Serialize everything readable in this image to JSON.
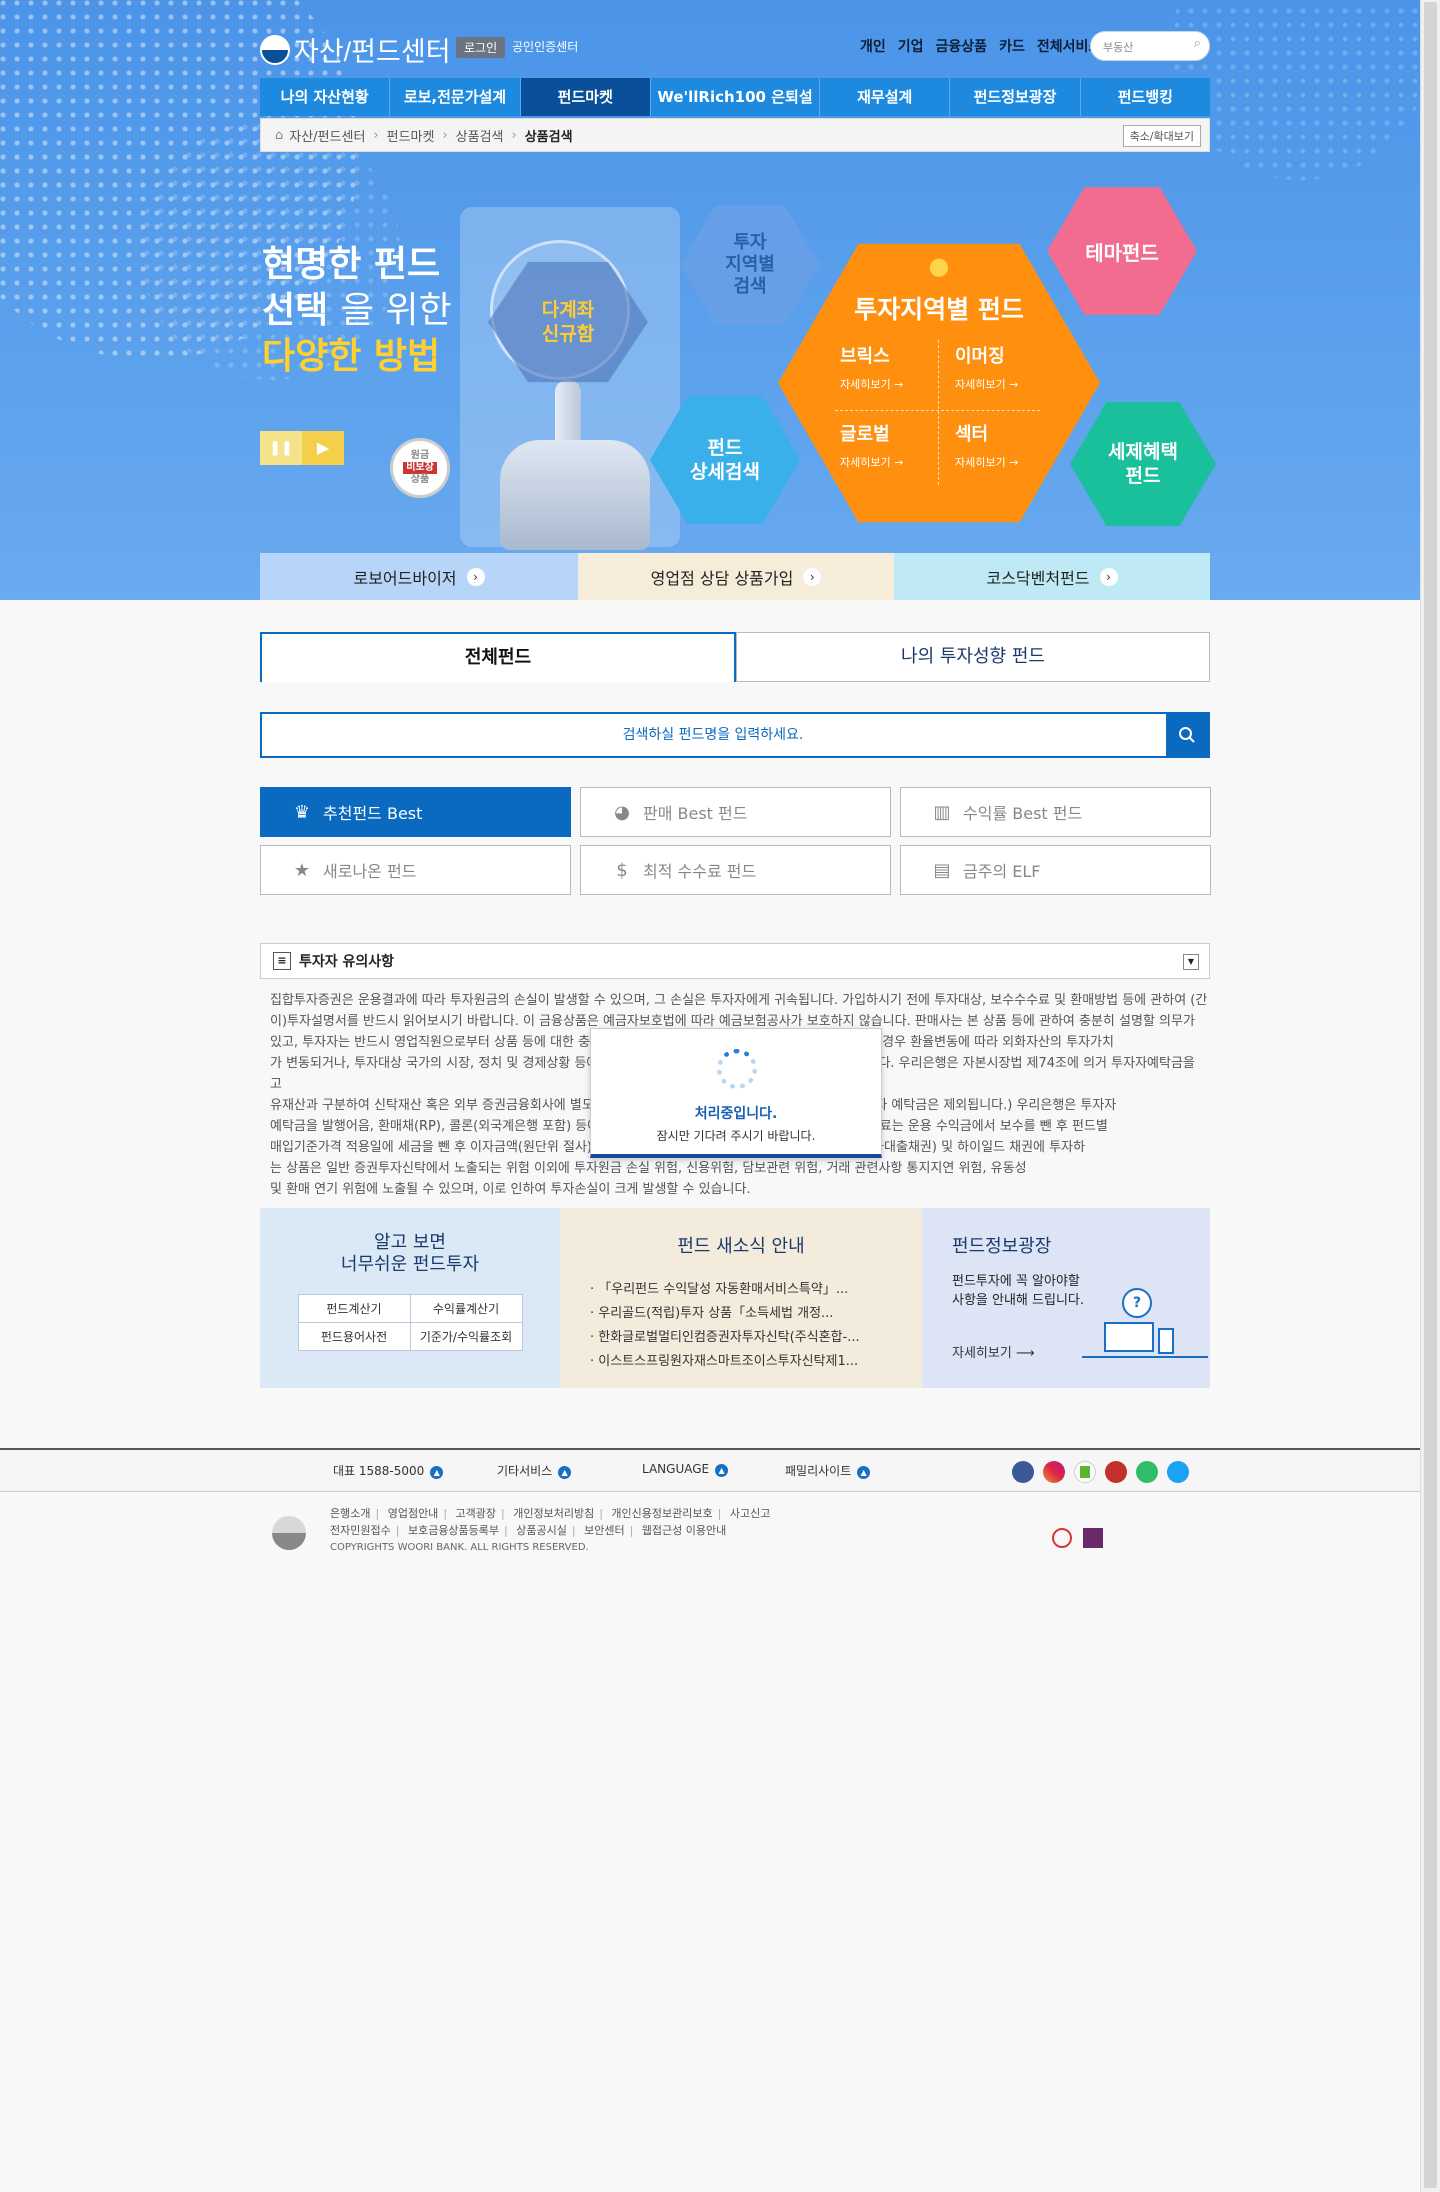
{
  "header": {
    "logo_text": "자산/펀드센터",
    "login_label": "로그인",
    "cert_label": "공인인증센터",
    "topnav": [
      "개인",
      "기업",
      "금융상품",
      "카드",
      "전체서비스"
    ],
    "search_placeholder": "부동산"
  },
  "gnb": [
    "나의 자산현황",
    "로보,전문가설계",
    "펀드마켓",
    "We'llRich100 은퇴설계",
    "재무설계",
    "펀드정보광장",
    "펀드뱅킹"
  ],
  "gnb_active": 2,
  "breadcrumb": [
    "자산/펀드센터",
    "펀드마켓",
    "상품검색",
    "상품검색"
  ],
  "zoom_label": "축소/확대보기",
  "hero": {
    "headline1": "현명한 펀드",
    "headline2a": "선택",
    "headline2b": "을 위한",
    "headline3": "다양한 방법",
    "badge_multi": "다계좌\n신규함",
    "badge_nonprotect": [
      "원금",
      "비보장",
      "상품"
    ],
    "hex_region_search": "투자\n지역별\n검색",
    "hex_theme": "테마펀드",
    "hex_detail": "펀드\n상세검색",
    "hex_tax": "세제혜택\n펀드",
    "main_hex": {
      "title": "투자지역별 펀드",
      "items": [
        {
          "label": "브릭스",
          "more": "자세히보기 →"
        },
        {
          "label": "이머징",
          "more": "자세히보기 →"
        },
        {
          "label": "글로벌",
          "more": "자세히보기 →"
        },
        {
          "label": "섹터",
          "more": "자세히보기 →"
        }
      ]
    }
  },
  "quick_links": [
    "로보어드바이저",
    "영업점 상담 상품가입",
    "코스닥벤처펀드"
  ],
  "tabs": [
    "전체펀드",
    "나의 투자성향 펀드"
  ],
  "search": {
    "placeholder": "검색하실 펀드명을 입력하세요."
  },
  "categories": [
    {
      "label": "추천펀드 Best",
      "icon": "crown-icon"
    },
    {
      "label": "판매 Best 펀드",
      "icon": "pie-icon"
    },
    {
      "label": "수익률 Best 펀드",
      "icon": "bar-chart-icon"
    },
    {
      "label": "새로나온 펀드",
      "icon": "star-icon"
    },
    {
      "label": "최적 수수료 펀드",
      "icon": "money-bag-icon"
    },
    {
      "label": "금주의 ELF",
      "icon": "briefcase-icon"
    }
  ],
  "notice": {
    "title": "투자자 유의사항",
    "lines": [
      "집합투자증권은 운용결과에 따라 투자원금의 손실이 발생할 수 있으며, 그 손실은 투자자에게 귀속됩니다. 가입하시기 전에 투자대상, 보수수수료 및 환매방법 등에 관하여 (간",
      "이)투자설명서를 반드시 읽어보시기 바랍니다. 이 금융상품은 예금자보호법에 따라 예금보험공사가 보호하지 않습니다. 판매사는 본 상품 등에 관하여 충분히 설명할 의무가",
      "있고, 투자자는 반드시 영업직원으로부터 상품 등에 대한 충분한 설명을 받으시기 바랍니다. 해외자산에 투자하는 경우 환율변동에 따라 외화자산의 투자가치",
      "가 변동되거나, 투자대상 국가의 시장, 정치 및 경제상황 등에 따른 위험으로 자산가치의 손실이 발생할 수 있습니다. 우리은행은 자본시장법 제74조에 의거 투자자예탁금을 고",
      "유재산과 구분하여 신탁재산 혹은 외부 증권금융회사에 별도로 예치하고 있습니다. (단, 펀드매수 대기 중인 투자자 예탁금은 제외됩니다.) 우리은행은 투자자",
      "예탁금을 발행어음, 환매채(RP), 콜론(외국계은행 포함) 등에 운용할 수 있으며, 관련 법령에 따라 운용하며, 이용료는 운용 수익금에서 보수를 뺀 후 펀드별",
      "매입기준가격 적용일에 세금을 뺀 후 이자금액(원단위 절사)을 지급합니다. 해당 펀드는 투자적격등급 미만의 외화대출채권) 및 하이일드 채권에 투자하",
      "는 상품은 일반 증권투자신탁에서 노출되는 위험 이외에 투자원금 손실 위험, 신용위험, 담보관련 위험, 거래 관련사항 통지지연 위험, 유동성",
      "및 환매 연기 위험에 노출될 수 있으며, 이로 인하여 투자손실이 크게 발생할 수 있습니다."
    ]
  },
  "modal": {
    "title": "처리중입니다.",
    "message": "잠시만 기다려 주시기 바랍니다."
  },
  "box_easy": {
    "title1": "알고 보면",
    "title2": "너무쉬운 펀드투자",
    "cells": [
      "펀드계산기",
      "수익률계산기",
      "펀드용어사전",
      "기준가/수익률조회"
    ]
  },
  "box_news": {
    "title": "펀드 새소식 안내",
    "items": [
      "「우리펀드 수익달성 자동환매서비스특약」...",
      "우리골드(적립)투자 상품「소득세법 개정...",
      "한화글로벌멀티인컴증권자투자신탁(주식혼합-...",
      "이스트스프링원자재스마트조이스투자신탁제1..."
    ]
  },
  "box_info": {
    "title": "펀드정보광장",
    "desc1": "펀드투자에 꼭 알아야할",
    "desc2": "사항을 안내해 드립니다.",
    "more": "자세히보기"
  },
  "footer": {
    "bar": [
      "대표 1588-5000",
      "기타서비스",
      "LANGUAGE",
      "패밀리사이트"
    ],
    "sns": [
      "facebook-icon",
      "instagram-icon",
      "kakaostory-icon",
      "youtube-icon",
      "play-icon",
      "twitter-icon"
    ],
    "links1": [
      "은행소개",
      "영업점안내",
      "고객광장",
      "개인정보처리방침",
      "개인신용정보관리보호",
      "사고신고"
    ],
    "links2": [
      "전자민원접수",
      "보호금융상품등록부",
      "상품공시실",
      "보안센터",
      "웹접근성 이용안내"
    ],
    "copyright": "COPYRIGHTS WOORI BANK. ALL RIGHTS RESERVED."
  }
}
